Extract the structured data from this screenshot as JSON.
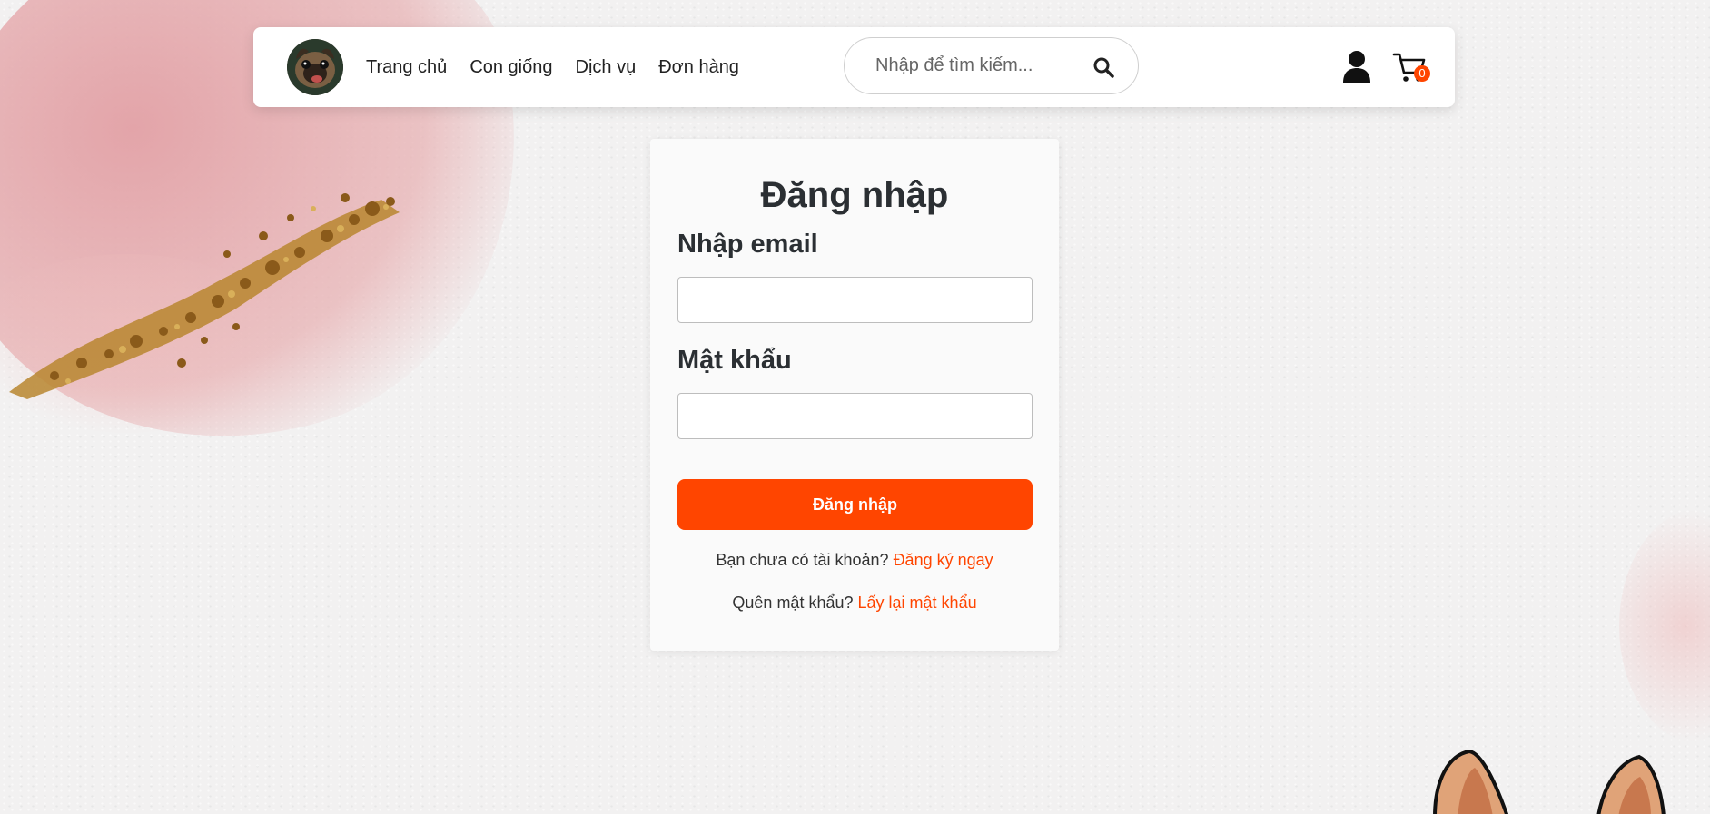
{
  "nav": {
    "items": [
      {
        "label": "Trang chủ"
      },
      {
        "label": "Con giống"
      },
      {
        "label": "Dịch vụ"
      },
      {
        "label": "Đơn hàng"
      }
    ]
  },
  "search": {
    "placeholder": "Nhập để tìm kiếm...",
    "icon": "search-icon"
  },
  "header_icons": {
    "user": "user-icon",
    "cart": "cart-icon",
    "cart_count": "0"
  },
  "login": {
    "title": "Đăng nhập",
    "email_label": "Nhập email",
    "email_value": "",
    "password_label": "Mật khẩu",
    "password_value": "",
    "submit_label": "Đăng nhập",
    "register_prompt": "Bạn chưa có tài khoản?",
    "register_link": "Đăng ký ngay",
    "forgot_prompt": "Quên mật khẩu?",
    "forgot_link": "Lấy lại mật khẩu"
  },
  "colors": {
    "accent": "#ff4500",
    "text_dark": "#2b2f33",
    "header_bg": "#ffffff",
    "page_bg": "#f2f1f1"
  }
}
